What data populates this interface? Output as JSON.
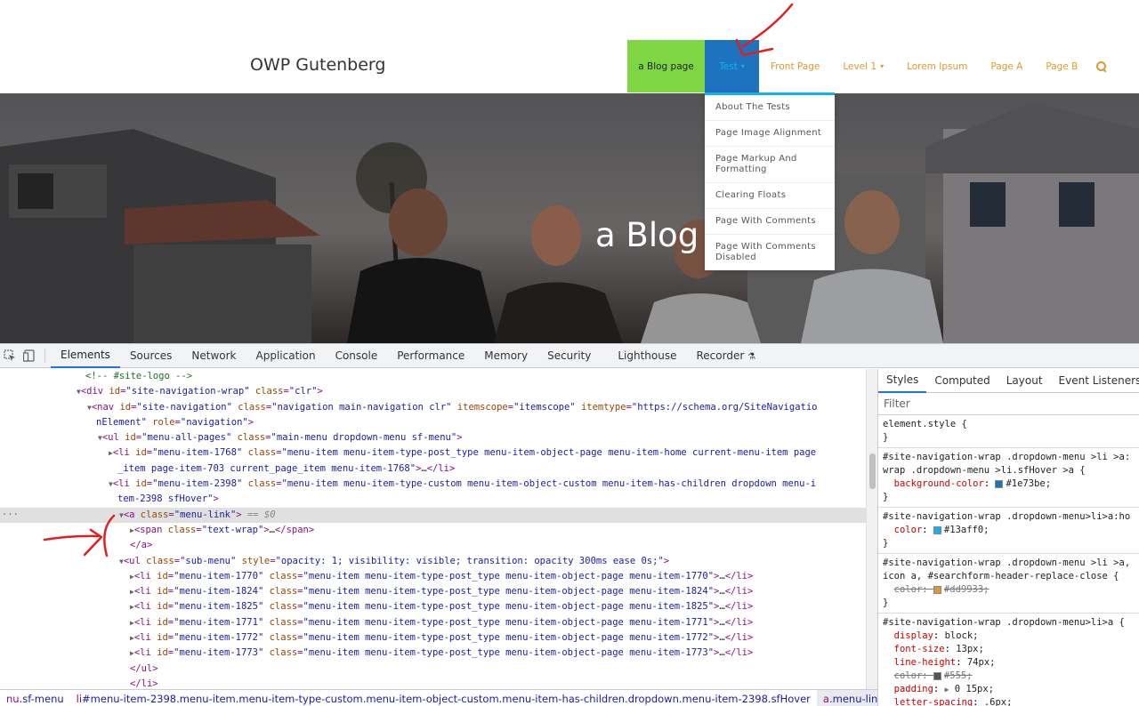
{
  "site": {
    "logo": "OWP Gutenberg",
    "nav": [
      {
        "label": "a Blog page"
      },
      {
        "label": "Test"
      },
      {
        "label": "Front Page"
      },
      {
        "label": "Level 1"
      },
      {
        "label": "Lorem Ipsum"
      },
      {
        "label": "Page A"
      },
      {
        "label": "Page B"
      }
    ],
    "hero_title": "a Blog p",
    "dropdown": [
      "About The Tests",
      "Page Image Alignment",
      "Page Markup And Formatting",
      "Clearing Floats",
      "Page With Comments",
      "Page With Comments Disabled"
    ]
  },
  "devtools": {
    "tabs": [
      "Elements",
      "Sources",
      "Network",
      "Application",
      "Console",
      "Performance",
      "Memory",
      "Security",
      "Lighthouse",
      "Recorder"
    ],
    "styles_tabs": [
      "Styles",
      "Computed",
      "Layout",
      "Event Listeners"
    ],
    "filter_placeholder": "Filter",
    "dom": {
      "comment": "<!-- #site-logo -->",
      "l1_tag": "div",
      "l1_id": "site-navigation-wrap",
      "l1_class": "clr",
      "l2_tag": "nav",
      "l2_id": "site-navigation",
      "l2_class": "navigation main-navigation clr",
      "l2_itemscope": "itemscope",
      "l2_itemtype_a": "https://schema.org/SiteNavigatio",
      "l2_itemtype_b": "nElement",
      "l2_role": "navigation",
      "l3_id": "menu-all-pages",
      "l3_class": "main-menu dropdown-menu sf-menu",
      "l4_id": "menu-item-1768",
      "l4_class_a": "menu-item menu-item-type-post_type menu-item-object-page menu-item-home current-menu-item page",
      "l4_class_b": "_item page-item-703 current_page_item menu-item-1768",
      "l5_id": "menu-item-2398",
      "l5_class_a": "menu-item menu-item-type-custom menu-item-object-custom menu-item-has-children dropdown menu-i",
      "l5_class_b": "tem-2398 sfHover",
      "sel_class": "menu-link",
      "sel_eq": "== $0",
      "span_class": "text-wrap",
      "ul_class": "sub-menu",
      "ul_style": "opacity: 1; visibility: visible; transition: opacity 300ms ease 0s;",
      "sub_items": [
        {
          "id": "menu-item-1770",
          "cls": "menu-item menu-item-type-post_type menu-item-object-page menu-item-1770"
        },
        {
          "id": "menu-item-1824",
          "cls": "menu-item menu-item-type-post_type menu-item-object-page menu-item-1824"
        },
        {
          "id": "menu-item-1825",
          "cls": "menu-item menu-item-type-post_type menu-item-object-page menu-item-1825"
        },
        {
          "id": "menu-item-1771",
          "cls": "menu-item menu-item-type-post_type menu-item-object-page menu-item-1771"
        },
        {
          "id": "menu-item-1772",
          "cls": "menu-item menu-item-type-post_type menu-item-object-page menu-item-1772"
        },
        {
          "id": "menu-item-1773",
          "cls": "menu-item menu-item-type-post_type menu-item-object-page menu-item-1773"
        }
      ]
    },
    "breadcrumbs": [
      {
        "tag": "nu",
        "cls": ".sf-menu"
      },
      {
        "tag": "li",
        "cls": "#menu-item-2398.menu-item.menu-item-type-custom.menu-item-object-custom.menu-item-has-children.dropdown.menu-item-2398.sfHover"
      },
      {
        "tag": "a",
        "cls": ".menu-link"
      }
    ],
    "styles": {
      "element_style": "element.style {",
      "r1_sel_a": "#site-navigation-wrap .dropdown-menu >li >a:",
      "r1_sel_b": "wrap .dropdown-menu >li.sfHover >a {",
      "r1_prop": "background-color",
      "r1_val": "#1e73be;",
      "r2_sel": "#site-navigation-wrap .dropdown-menu>li>a:ho",
      "r2_prop": "color",
      "r2_val": "#13aff0;",
      "r3_sel_a": "#site-navigation-wrap .dropdown-menu >li >a,",
      "r3_sel_b": "icon a, #searchform-header-replace-close {",
      "r3_prop": "color",
      "r3_val": "#dd9933;",
      "r4_sel": "#site-navigation-wrap .dropdown-menu>li>a {",
      "r4_props": [
        {
          "p": "display",
          "v": "block;"
        },
        {
          "p": "font-size",
          "v": "13px;"
        },
        {
          "p": "line-height",
          "v": "74px;"
        },
        {
          "p": "color",
          "v": "#555;"
        },
        {
          "p": "padding",
          "v": "0 15px;"
        },
        {
          "p": "letter-spacing",
          "v": ".6px;"
        }
      ]
    },
    "colors": {
      "swatch1": "#1e73be",
      "swatch2": "#13aff0",
      "swatch3": "#dd9933",
      "swatch4": "#555555"
    }
  }
}
